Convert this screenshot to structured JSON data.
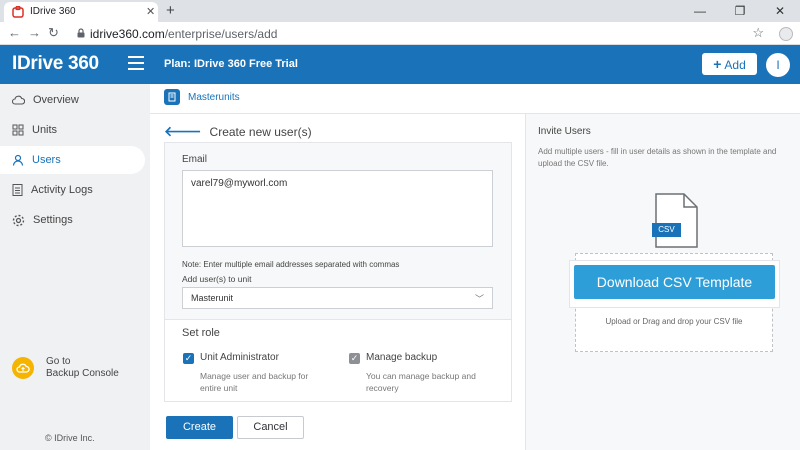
{
  "browser": {
    "tab_title": "IDrive 360",
    "tab_close": "✕",
    "new_tab": "+",
    "url_host": "idrive360.com",
    "url_path": "/enterprise/users/add",
    "win_min": "—",
    "win_restore": "❐",
    "win_close": "✕"
  },
  "header": {
    "logo": "IDrive 360",
    "plan": "Plan: IDrive 360 Free Trial",
    "add_label": "Add",
    "add_icon": "+",
    "avatar_letter": "I"
  },
  "sidebar": {
    "items": [
      {
        "label": "Overview",
        "icon": "cloud-icon"
      },
      {
        "label": "Units",
        "icon": "grid-icon"
      },
      {
        "label": "Users",
        "icon": "user-icon"
      },
      {
        "label": "Activity Logs",
        "icon": "document-icon"
      },
      {
        "label": "Settings",
        "icon": "gear-icon"
      }
    ],
    "active": "Users",
    "backup_line1": "Go to",
    "backup_line2": "Backup Console",
    "copyright": "© IDrive Inc."
  },
  "main": {
    "breadcrumb": "Masterunits",
    "title": "Create new user(s)",
    "email_label": "Email",
    "email_value": "varel79@myworl.com",
    "note": "Note: Enter multiple email addresses separated with commas",
    "unit_label": "Add user(s) to unit",
    "unit_value": "Masterunit",
    "set_role": "Set role",
    "role_admin_label": "Unit Administrator",
    "role_admin_desc": "Manage user and backup for entire unit",
    "role_backup_label": "Manage backup",
    "role_backup_desc": "You can manage backup and recovery",
    "create_label": "Create",
    "cancel_label": "Cancel"
  },
  "invite": {
    "title": "Invite Users",
    "desc": "Add multiple users - fill in user details as shown in the template and upload the CSV file.",
    "file_tag": "CSV",
    "download_label": "Download CSV Template",
    "drop_text": "Upload or Drag and drop your CSV file"
  },
  "colors": {
    "brand": "#1a73b9",
    "download_btn": "#2e9ed8",
    "backup_badge": "#f5b400"
  }
}
